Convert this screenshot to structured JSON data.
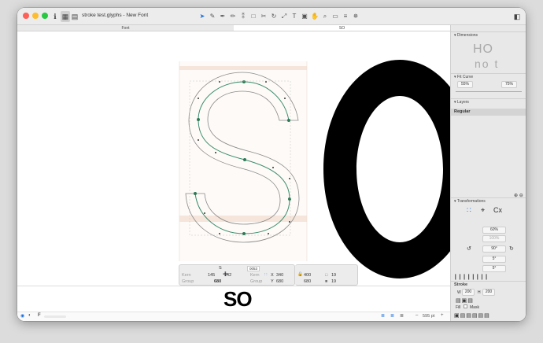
{
  "window": {
    "title": "stroke test.glyphs - New Font"
  },
  "tabs": [
    {
      "label": "Font"
    },
    {
      "label": "SO"
    }
  ],
  "canvas": {
    "glyph_text": "SO"
  },
  "infobox": {
    "glyph_name": "S",
    "unicode": "0053",
    "kern_label": "Kern",
    "group_label": "Group",
    "lsb": "145",
    "rsb": "142",
    "width": "680",
    "kern_right_label": "Kern",
    "group_right_label": "Group",
    "x_label": "X",
    "x_value": "340",
    "y_label": "Y",
    "y_value": "680",
    "w_value": "400",
    "h_value": "680",
    "box1": "19",
    "box2": "19"
  },
  "preview": {
    "text": "SO"
  },
  "statusbar": {
    "font_label": "F",
    "zoom": "595 pt",
    "minus": "–",
    "plus": "+"
  },
  "panel": {
    "dimensions": {
      "title": "Dimensions",
      "sample_top": "HO",
      "sample_bottom": "no t"
    },
    "fit_curve": {
      "title": "Fit Curve",
      "left": "55%",
      "right": "75%"
    },
    "layers": {
      "title": "Layers",
      "active": "Regular"
    },
    "transformations": {
      "title": "Transformations",
      "scale": "60%",
      "scale2": "100%",
      "rotate": "90°",
      "slant": "5°",
      "slant2": "5°"
    },
    "stroke": {
      "title": "Stroke",
      "w_label": "W",
      "w_value": "200",
      "h_label": "H",
      "h_value": "200",
      "fill_label": "Fill",
      "mask_label": "Mask"
    }
  },
  "colors": {
    "accent": "#1a6fe0",
    "path": "#3a8c6e",
    "node": "#2d7a55"
  }
}
